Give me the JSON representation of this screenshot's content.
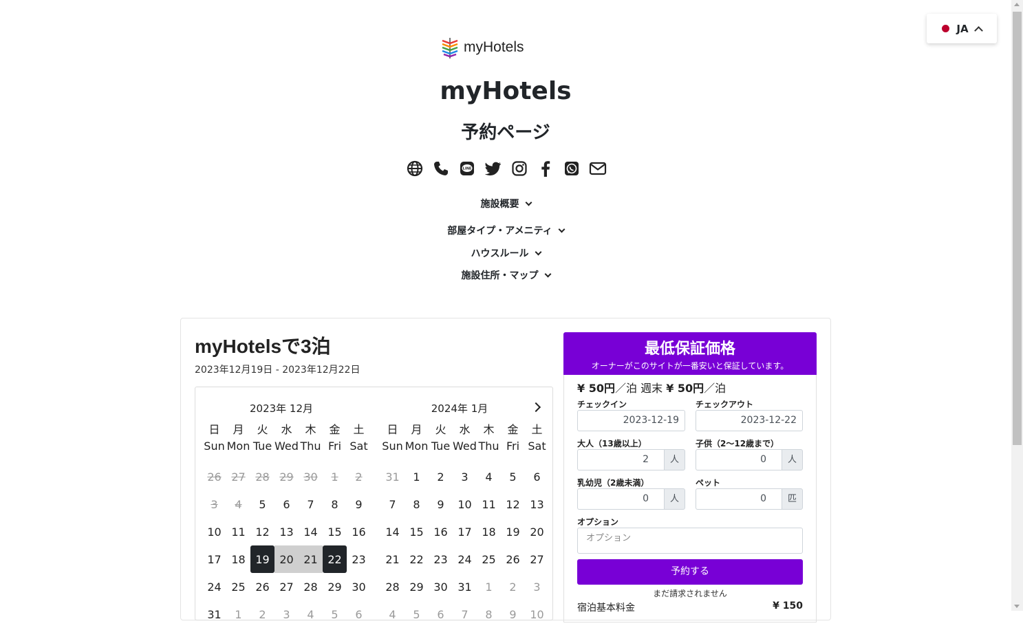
{
  "language": {
    "code": "JA",
    "flag_color": "#bc002d"
  },
  "brand": {
    "logo_text": "myHotels",
    "hotel_name": "myHotels",
    "page_title": "予約ページ"
  },
  "social_icons": [
    "globe-icon",
    "phone-icon",
    "line-icon",
    "twitter-icon",
    "instagram-icon",
    "facebook-icon",
    "whatsapp-icon",
    "envelope-icon"
  ],
  "accordions": [
    {
      "label": "施設概要"
    },
    {
      "label": "部屋タイプ・アメニティ"
    },
    {
      "label": "ハウスルール"
    },
    {
      "label": "施設住所・マップ"
    }
  ],
  "stay": {
    "title": "myHotelsで3泊",
    "dates": "2023年12月19日 - 2023年12月22日"
  },
  "calendar": {
    "weekdays_ja": [
      "日",
      "月",
      "火",
      "水",
      "木",
      "金",
      "土"
    ],
    "weekdays_en": [
      "Sun",
      "Mon",
      "Tue",
      "Wed",
      "Thu",
      "Fri",
      "Sat"
    ],
    "months": [
      {
        "title": "2023年 12月",
        "days": [
          {
            "d": "26",
            "s": "past"
          },
          {
            "d": "27",
            "s": "past"
          },
          {
            "d": "28",
            "s": "past"
          },
          {
            "d": "29",
            "s": "past"
          },
          {
            "d": "30",
            "s": "past"
          },
          {
            "d": "1",
            "s": "past"
          },
          {
            "d": "2",
            "s": "past"
          },
          {
            "d": "3",
            "s": "past"
          },
          {
            "d": "4",
            "s": "past"
          },
          {
            "d": "5",
            "s": ""
          },
          {
            "d": "6",
            "s": ""
          },
          {
            "d": "7",
            "s": ""
          },
          {
            "d": "8",
            "s": ""
          },
          {
            "d": "9",
            "s": ""
          },
          {
            "d": "10",
            "s": ""
          },
          {
            "d": "11",
            "s": ""
          },
          {
            "d": "12",
            "s": ""
          },
          {
            "d": "13",
            "s": ""
          },
          {
            "d": "14",
            "s": ""
          },
          {
            "d": "15",
            "s": ""
          },
          {
            "d": "16",
            "s": ""
          },
          {
            "d": "17",
            "s": ""
          },
          {
            "d": "18",
            "s": ""
          },
          {
            "d": "19",
            "s": "sel"
          },
          {
            "d": "20",
            "s": "range"
          },
          {
            "d": "21",
            "s": "range"
          },
          {
            "d": "22",
            "s": "sel"
          },
          {
            "d": "23",
            "s": ""
          },
          {
            "d": "24",
            "s": ""
          },
          {
            "d": "25",
            "s": ""
          },
          {
            "d": "26",
            "s": ""
          },
          {
            "d": "27",
            "s": ""
          },
          {
            "d": "28",
            "s": ""
          },
          {
            "d": "29",
            "s": ""
          },
          {
            "d": "30",
            "s": ""
          },
          {
            "d": "31",
            "s": ""
          },
          {
            "d": "1",
            "s": "other"
          },
          {
            "d": "2",
            "s": "other"
          },
          {
            "d": "3",
            "s": "other"
          },
          {
            "d": "4",
            "s": "other"
          },
          {
            "d": "5",
            "s": "other"
          },
          {
            "d": "6",
            "s": "other"
          }
        ]
      },
      {
        "title": "2024年 1月",
        "days": [
          {
            "d": "31",
            "s": "other"
          },
          {
            "d": "1",
            "s": ""
          },
          {
            "d": "2",
            "s": ""
          },
          {
            "d": "3",
            "s": ""
          },
          {
            "d": "4",
            "s": ""
          },
          {
            "d": "5",
            "s": ""
          },
          {
            "d": "6",
            "s": ""
          },
          {
            "d": "7",
            "s": ""
          },
          {
            "d": "8",
            "s": ""
          },
          {
            "d": "9",
            "s": ""
          },
          {
            "d": "10",
            "s": ""
          },
          {
            "d": "11",
            "s": ""
          },
          {
            "d": "12",
            "s": ""
          },
          {
            "d": "13",
            "s": ""
          },
          {
            "d": "14",
            "s": ""
          },
          {
            "d": "15",
            "s": ""
          },
          {
            "d": "16",
            "s": ""
          },
          {
            "d": "17",
            "s": ""
          },
          {
            "d": "18",
            "s": ""
          },
          {
            "d": "19",
            "s": ""
          },
          {
            "d": "20",
            "s": ""
          },
          {
            "d": "21",
            "s": ""
          },
          {
            "d": "22",
            "s": ""
          },
          {
            "d": "23",
            "s": ""
          },
          {
            "d": "24",
            "s": ""
          },
          {
            "d": "25",
            "s": ""
          },
          {
            "d": "26",
            "s": ""
          },
          {
            "d": "27",
            "s": ""
          },
          {
            "d": "28",
            "s": ""
          },
          {
            "d": "29",
            "s": ""
          },
          {
            "d": "30",
            "s": ""
          },
          {
            "d": "31",
            "s": ""
          },
          {
            "d": "1",
            "s": "other"
          },
          {
            "d": "2",
            "s": "other"
          },
          {
            "d": "3",
            "s": "other"
          },
          {
            "d": "4",
            "s": "other"
          },
          {
            "d": "5",
            "s": "other"
          },
          {
            "d": "6",
            "s": "other"
          },
          {
            "d": "7",
            "s": "other"
          },
          {
            "d": "8",
            "s": "other"
          },
          {
            "d": "9",
            "s": "other"
          },
          {
            "d": "10",
            "s": "other"
          }
        ]
      }
    ]
  },
  "promo": {
    "title": "最低保証価格",
    "subtitle": "オーナーがこのサイトが一番安いと保証しています。",
    "color": "#7800d6"
  },
  "price": {
    "weekday": "¥ 50円",
    "per_night": "／泊",
    "weekend_label": " 週末 ",
    "weekend": "¥ 50円",
    "weekend_per_night": "／泊"
  },
  "form": {
    "checkin_label": "チェックイン",
    "checkin_value": "2023-12-19",
    "checkout_label": "チェックアウト",
    "checkout_value": "2023-12-22",
    "adults_label": "大人（13歳以上）",
    "adults_value": "2",
    "adults_unit": "人",
    "children_label": "子供（2〜12歳まで）",
    "children_value": "0",
    "children_unit": "人",
    "infants_label": "乳幼児（2歳未満）",
    "infants_value": "0",
    "infants_unit": "人",
    "pets_label": "ペット",
    "pets_value": "0",
    "pets_unit": "匹",
    "options_label": "オプション",
    "options_placeholder": "オプション",
    "book_label": "予約する",
    "not_charged": "まだ請求されません",
    "base_fee_label": "宿泊基本料金",
    "base_fee_value": "¥ 150"
  }
}
